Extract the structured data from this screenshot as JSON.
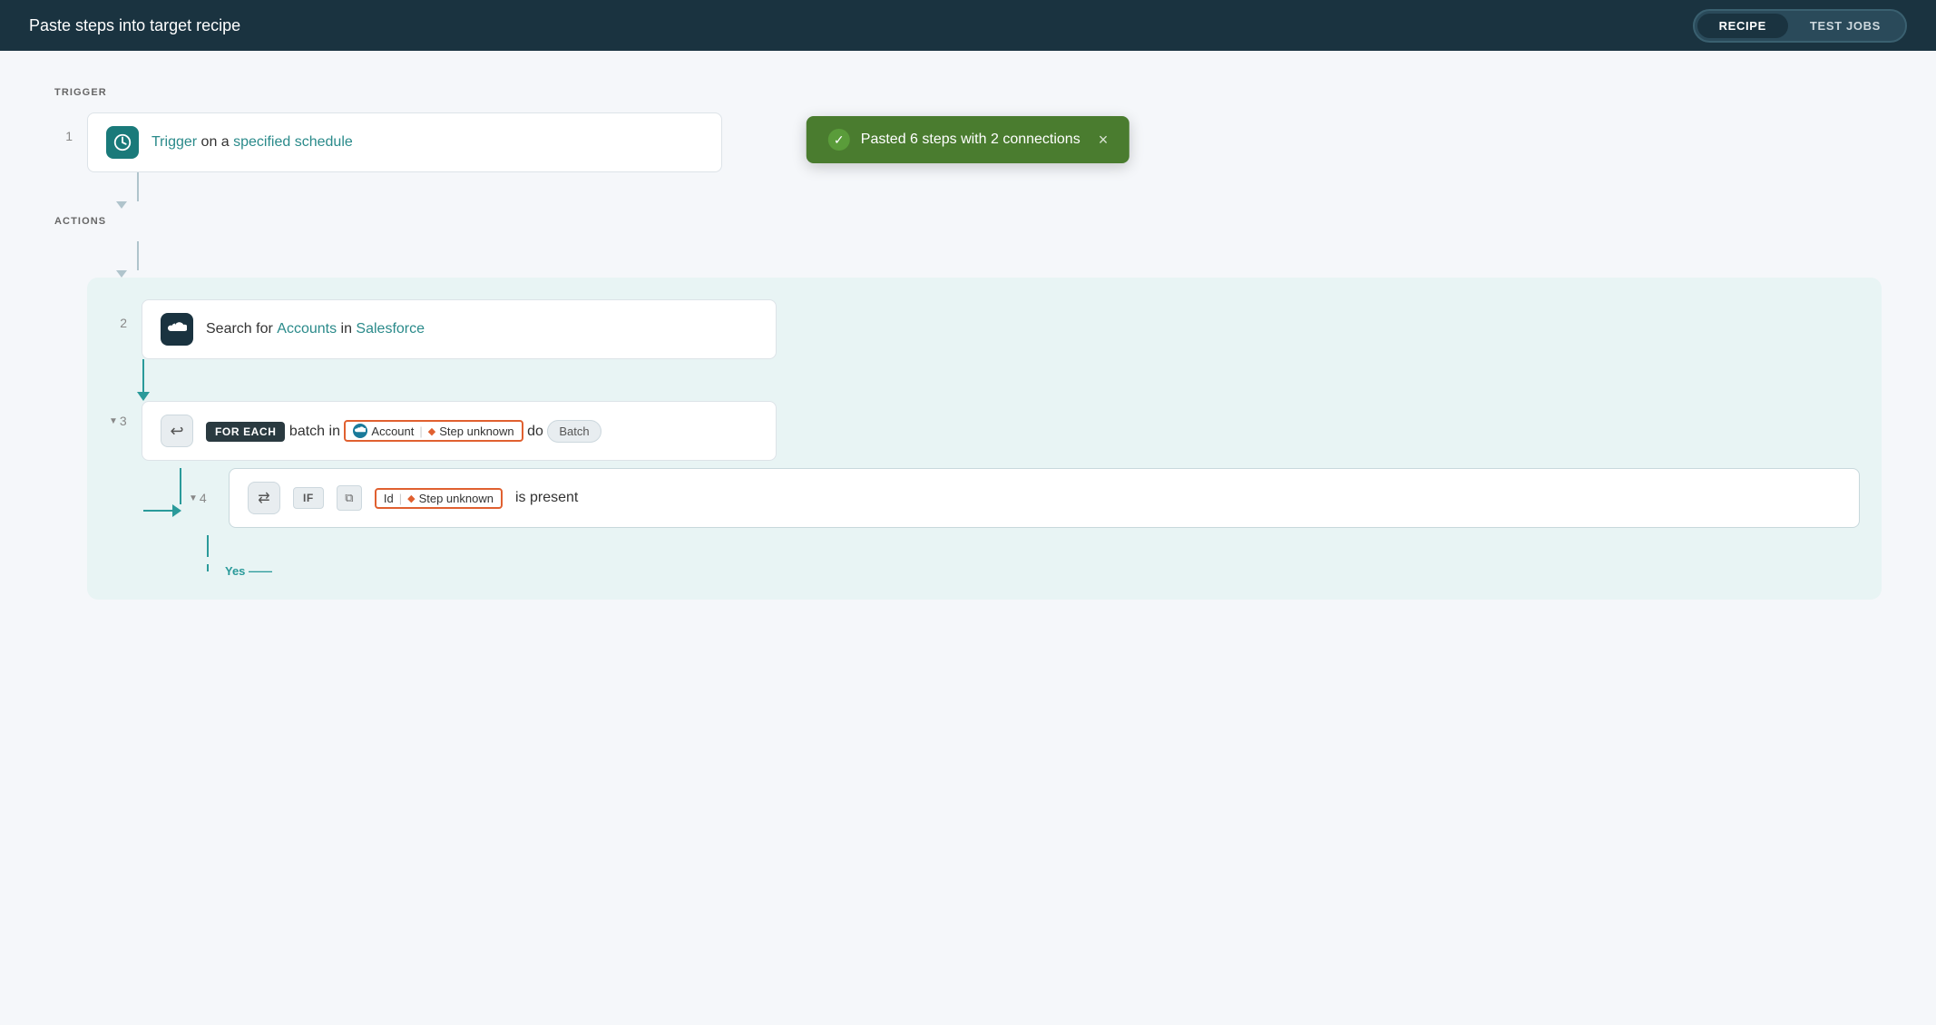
{
  "header": {
    "title": "Paste steps into target recipe"
  },
  "tabs": {
    "recipe_label": "RECIPE",
    "test_jobs_label": "TEST JOBS",
    "active": "recipe"
  },
  "toast": {
    "message": "Pasted 6 steps with 2 connections",
    "close_label": "×"
  },
  "sections": {
    "trigger_label": "TRIGGER",
    "actions_label": "ACTIONS"
  },
  "steps": {
    "step1": {
      "number": "1",
      "trigger_prefix": "Trigger",
      "trigger_middle": " on a ",
      "trigger_link": "specified schedule"
    },
    "step2": {
      "number": "2",
      "text_prefix": "Search for ",
      "accounts_link": "Accounts",
      "text_middle": " in ",
      "salesforce_link": "Salesforce"
    },
    "step3": {
      "number": "3",
      "foreach_badge": "FOR EACH",
      "batch_in_text": " batch in ",
      "account_label": "Account",
      "pipe": "|",
      "step_unknown": "Step unknown",
      "do_text": " do ",
      "batch_badge": "Batch"
    },
    "step4": {
      "number": "4",
      "if_badge": "IF",
      "id_label": "Id",
      "pipe": "|",
      "step_unknown": "Step unknown",
      "is_present_text": " is present"
    }
  },
  "icons": {
    "clock": "🕐",
    "loop": "↩",
    "check": "✓",
    "copy": "⧉",
    "condition": "⇄",
    "close": "×"
  },
  "colors": {
    "teal_dark": "#1a7a7a",
    "teal_mid": "#2a9a9a",
    "salesforce_dark": "#1a3340",
    "orange": "#e06030",
    "green_toast": "#4a7c2f",
    "gray_connector": "#b0c4cc"
  }
}
